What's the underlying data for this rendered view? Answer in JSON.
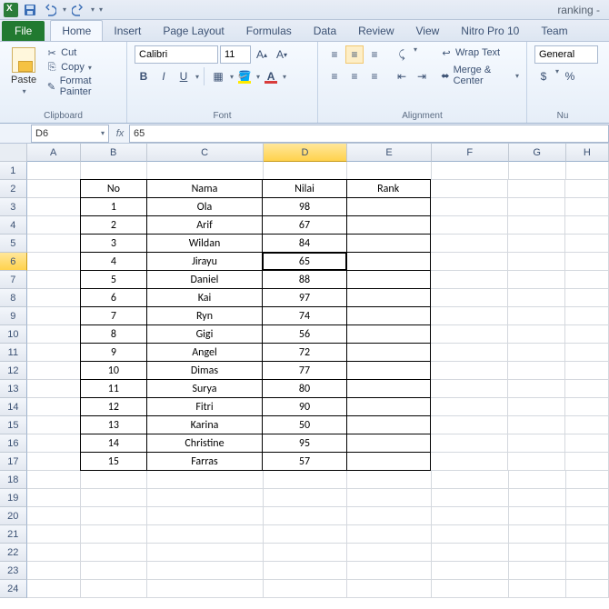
{
  "titlebar": {
    "document_name": "ranking -"
  },
  "tabs": {
    "file": "File",
    "items": [
      "Home",
      "Insert",
      "Page Layout",
      "Formulas",
      "Data",
      "Review",
      "View",
      "Nitro Pro 10",
      "Team"
    ],
    "active": "Home"
  },
  "ribbon": {
    "clipboard": {
      "label": "Clipboard",
      "paste": "Paste",
      "cut": "Cut",
      "copy": "Copy",
      "format_painter": "Format Painter"
    },
    "font": {
      "label": "Font",
      "name": "Calibri",
      "size": "11"
    },
    "alignment": {
      "label": "Alignment",
      "wrap_text": "Wrap Text",
      "merge_center": "Merge & Center"
    },
    "number": {
      "label": "Nu",
      "format": "General",
      "currency": "$",
      "percent": "%"
    }
  },
  "formula_bar": {
    "cell_ref": "D6",
    "value": "65"
  },
  "columns": [
    "A",
    "B",
    "C",
    "D",
    "E",
    "F",
    "G",
    "H"
  ],
  "selected_col": "D",
  "selected_row": 6,
  "table": {
    "headers": {
      "no": "No",
      "nama": "Nama",
      "nilai": "Nilai",
      "rank": "Rank"
    },
    "rows": [
      {
        "no": "1",
        "nama": "Ola",
        "nilai": "98",
        "rank": ""
      },
      {
        "no": "2",
        "nama": "Arif",
        "nilai": "67",
        "rank": ""
      },
      {
        "no": "3",
        "nama": "Wildan",
        "nilai": "84",
        "rank": ""
      },
      {
        "no": "4",
        "nama": "Jirayu",
        "nilai": "65",
        "rank": ""
      },
      {
        "no": "5",
        "nama": "Daniel",
        "nilai": "88",
        "rank": ""
      },
      {
        "no": "6",
        "nama": "Kai",
        "nilai": "97",
        "rank": ""
      },
      {
        "no": "7",
        "nama": "Ryn",
        "nilai": "74",
        "rank": ""
      },
      {
        "no": "8",
        "nama": "Gigi",
        "nilai": "56",
        "rank": ""
      },
      {
        "no": "9",
        "nama": "Angel",
        "nilai": "72",
        "rank": ""
      },
      {
        "no": "10",
        "nama": "Dimas",
        "nilai": "77",
        "rank": ""
      },
      {
        "no": "11",
        "nama": "Surya",
        "nilai": "80",
        "rank": ""
      },
      {
        "no": "12",
        "nama": "Fitri",
        "nilai": "90",
        "rank": ""
      },
      {
        "no": "13",
        "nama": "Karina",
        "nilai": "50",
        "rank": ""
      },
      {
        "no": "14",
        "nama": "Christine",
        "nilai": "95",
        "rank": ""
      },
      {
        "no": "15",
        "nama": "Farras",
        "nilai": "57",
        "rank": ""
      }
    ]
  },
  "total_rows": 24
}
